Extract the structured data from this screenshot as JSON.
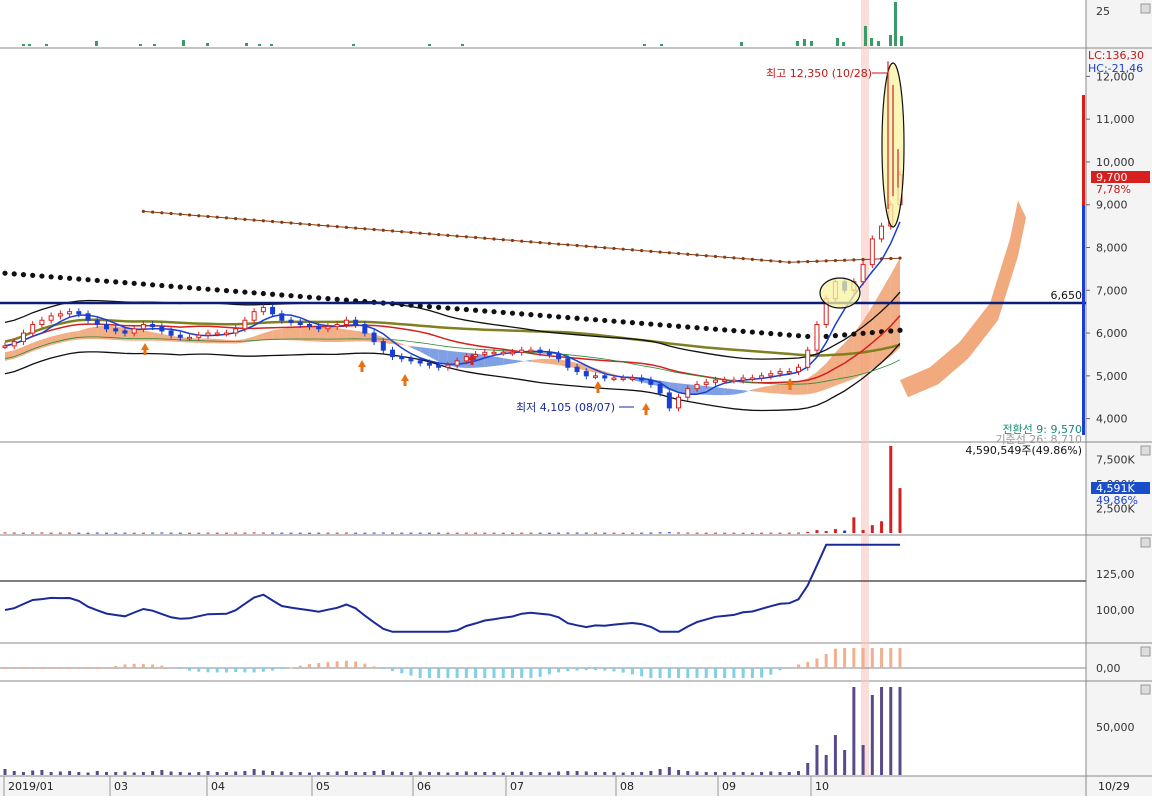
{
  "colors": {
    "up": "#d62020",
    "down": "#1a3fd0",
    "navy": "#0b1f7a",
    "brown": "#8b3a10",
    "olive": "#808020",
    "cloud_up": "#f0a070",
    "cloud_down": "#6a8fe0",
    "highlight": "#f8c8c0",
    "ellipse": "#f7f3a0",
    "panel_bg": "#ffffff",
    "axis_bg": "#f2f2f2",
    "grid": "#dddddd"
  },
  "top_panel": {
    "axis_label": "25"
  },
  "price_panel": {
    "lc_label": "LC:136,30",
    "hc_label": "HC:-21,46",
    "axis_labels": [
      "12,000",
      "11,000",
      "10,000",
      "9,000",
      "8,000",
      "7,000",
      "6,000",
      "5,000",
      "4,000"
    ],
    "current_price": "9,700",
    "current_change": "7,78%",
    "hline_label": "6,650",
    "high_annotation": "최고 12,350 (10/28)",
    "low_annotation": "최저 4,105 (08/07)",
    "bottom_note": "전환선 9: 9,570",
    "bottom_note2": "기준선 26: 8,710"
  },
  "volume_panel": {
    "top_label": "4,590,549주(49.86%)",
    "axis_labels": [
      "7,500K",
      "5,000K",
      "2,500K"
    ],
    "current_value": "4,591K",
    "current_pct": "49,86%"
  },
  "osc_panel": {
    "axis_labels": [
      "125,00",
      "100,00"
    ]
  },
  "macd_panel": {
    "axis_labels": [
      "0,00"
    ]
  },
  "bottom_panel": {
    "axis_labels": [
      "50,000"
    ]
  },
  "x_axis": {
    "labels": [
      "2019/01",
      "03",
      "04",
      "05",
      "06",
      "07",
      "08",
      "09",
      "10"
    ],
    "right_label": "10/29"
  },
  "chart_data": {
    "type": "candlestick",
    "period_start": "2019/01",
    "period_end": "10/29",
    "y_range": [
      3500,
      12500
    ],
    "annotations": {
      "high": {
        "label": "최고 12,350 (10/28)",
        "value": 12350,
        "date": "10/28"
      },
      "low": {
        "label": "최저 4,105 (08/07)",
        "value": 4105,
        "date": "08/07"
      },
      "horizontal_line": 6650
    },
    "last_close": 9700,
    "last_change_pct": 7.78,
    "last_volume": 4590549,
    "last_volume_pct": 49.86,
    "close_series": [
      5700,
      5800,
      6000,
      6200,
      6300,
      6400,
      6450,
      6500,
      6450,
      6300,
      6200,
      6100,
      6050,
      6000,
      6100,
      6200,
      6150,
      6050,
      5950,
      5900,
      5900,
      5950,
      6000,
      6000,
      6000,
      6100,
      6300,
      6500,
      6600,
      6450,
      6300,
      6250,
      6200,
      6150,
      6100,
      6150,
      6200,
      6300,
      6200,
      6000,
      5800,
      5600,
      5450,
      5400,
      5350,
      5300,
      5250,
      5200,
      5250,
      5350,
      5450,
      5500,
      5550,
      5550,
      5550,
      5550,
      5600,
      5600,
      5550,
      5500,
      5400,
      5200,
      5100,
      5000,
      5000,
      4950,
      4950,
      4950,
      4950,
      4900,
      4800,
      4600,
      4250,
      4500,
      4700,
      4800,
      4850,
      4900,
      4900,
      4900,
      4950,
      4950,
      5000,
      5050,
      5100,
      5100,
      5200,
      5600,
      6200,
      6800,
      7200,
      7000,
      7200,
      7600,
      8200,
      8500,
      9000,
      9700
    ],
    "volume_K": [
      60,
      40,
      30,
      45,
      50,
      30,
      35,
      40,
      30,
      25,
      40,
      30,
      30,
      35,
      25,
      30,
      40,
      50,
      35,
      30,
      25,
      30,
      40,
      30,
      30,
      35,
      40,
      60,
      45,
      40,
      35,
      30,
      30,
      25,
      30,
      30,
      35,
      40,
      30,
      30,
      40,
      50,
      35,
      30,
      30,
      35,
      30,
      30,
      25,
      30,
      35,
      30,
      30,
      30,
      25,
      30,
      35,
      30,
      30,
      25,
      35,
      40,
      40,
      35,
      30,
      30,
      30,
      25,
      30,
      30,
      40,
      60,
      80,
      50,
      40,
      35,
      30,
      30,
      30,
      30,
      30,
      25,
      30,
      35,
      30,
      30,
      40,
      120,
      300,
      200,
      400,
      250,
      1600,
      300,
      800,
      1200,
      8900,
      4591
    ]
  }
}
